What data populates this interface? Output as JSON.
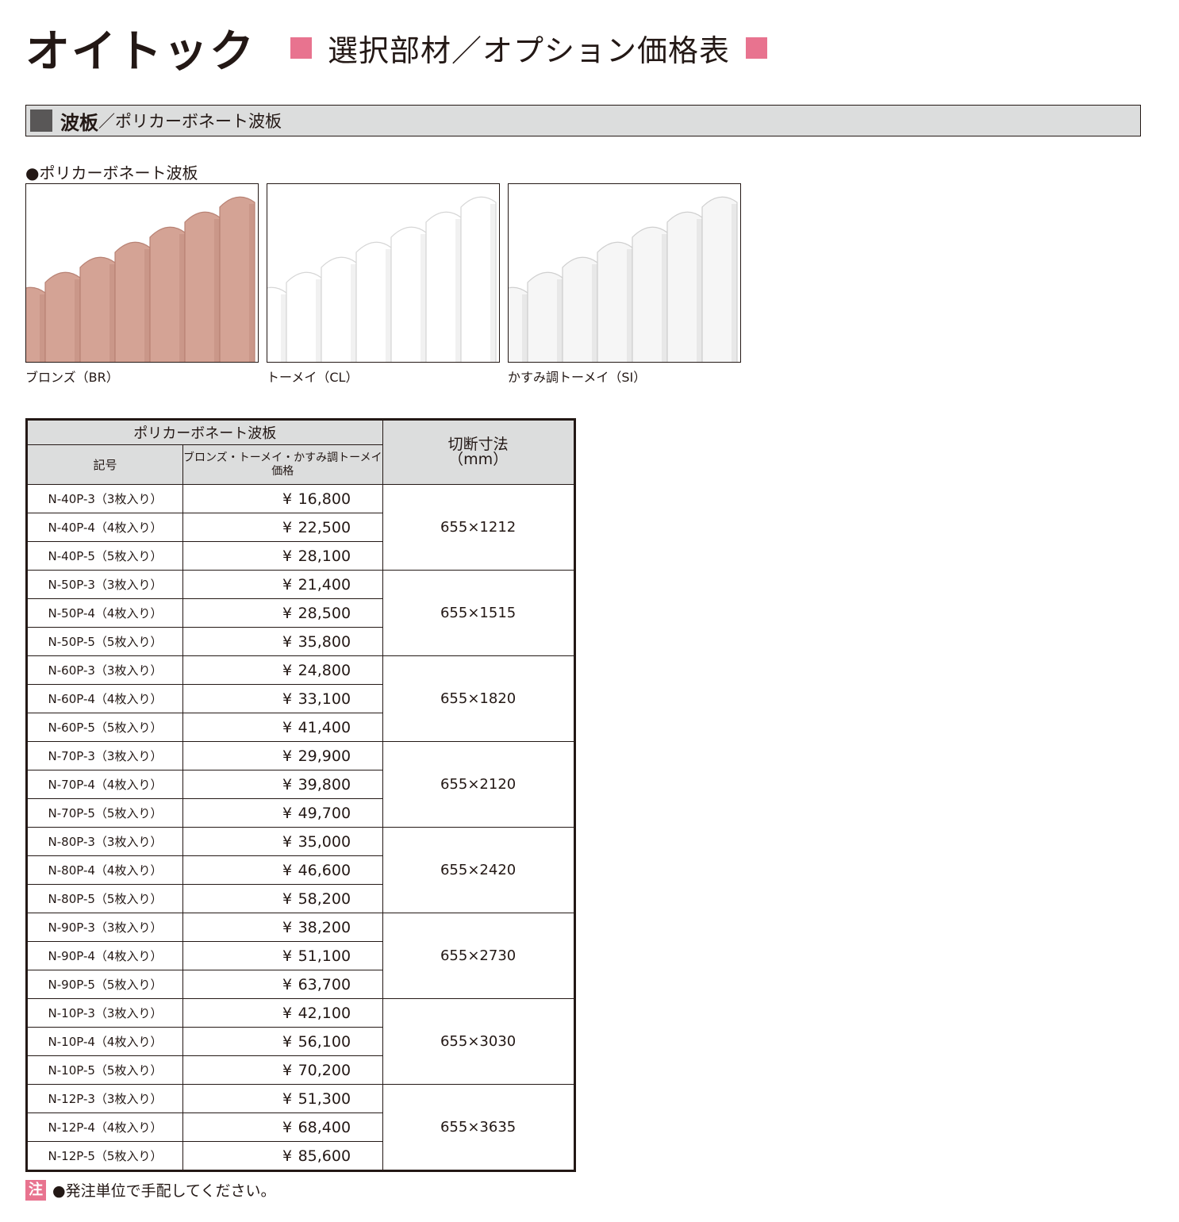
{
  "header": {
    "brand": "オイトック",
    "subtitle": "選択部材／オプション価格表"
  },
  "section": {
    "main": "波板",
    "sub": "／ポリカーボネート波板"
  },
  "products": {
    "heading": "●ポリカーボネート波板",
    "swatches": [
      {
        "caption": "ブロンズ（BR）",
        "color": "#d4a395",
        "edge": "#b88274"
      },
      {
        "caption": "トーメイ（CL）",
        "color": "#ffffff",
        "edge": "#d6d6d6"
      },
      {
        "caption": "かすみ調トーメイ（SI）",
        "color": "#f6f6f6",
        "edge": "#cfcfcf"
      }
    ]
  },
  "table": {
    "group_header": "ポリカーボネート波板",
    "code_header": "記号",
    "price_header_line1": "ブロンズ・トーメイ・かすみ調トーメイ",
    "price_header_line2": "価格",
    "cut_header_line1": "切断寸法",
    "cut_header_line2": "（mm）",
    "currency": "¥",
    "groups": [
      {
        "size": "655×1212",
        "rows": [
          {
            "code": "N-40P-3（3枚入り）",
            "price": "16,800"
          },
          {
            "code": "N-40P-4（4枚入り）",
            "price": "22,500"
          },
          {
            "code": "N-40P-5（5枚入り）",
            "price": "28,100"
          }
        ]
      },
      {
        "size": "655×1515",
        "rows": [
          {
            "code": "N-50P-3（3枚入り）",
            "price": "21,400"
          },
          {
            "code": "N-50P-4（4枚入り）",
            "price": "28,500"
          },
          {
            "code": "N-50P-5（5枚入り）",
            "price": "35,800"
          }
        ]
      },
      {
        "size": "655×1820",
        "rows": [
          {
            "code": "N-60P-3（3枚入り）",
            "price": "24,800"
          },
          {
            "code": "N-60P-4（4枚入り）",
            "price": "33,100"
          },
          {
            "code": "N-60P-5（5枚入り）",
            "price": "41,400"
          }
        ]
      },
      {
        "size": "655×2120",
        "rows": [
          {
            "code": "N-70P-3（3枚入り）",
            "price": "29,900"
          },
          {
            "code": "N-70P-4（4枚入り）",
            "price": "39,800"
          },
          {
            "code": "N-70P-5（5枚入り）",
            "price": "49,700"
          }
        ]
      },
      {
        "size": "655×2420",
        "rows": [
          {
            "code": "N-80P-3（3枚入り）",
            "price": "35,000"
          },
          {
            "code": "N-80P-4（4枚入り）",
            "price": "46,600"
          },
          {
            "code": "N-80P-5（5枚入り）",
            "price": "58,200"
          }
        ]
      },
      {
        "size": "655×2730",
        "rows": [
          {
            "code": "N-90P-3（3枚入り）",
            "price": "38,200"
          },
          {
            "code": "N-90P-4（4枚入り）",
            "price": "51,100"
          },
          {
            "code": "N-90P-5（5枚入り）",
            "price": "63,700"
          }
        ]
      },
      {
        "size": "655×3030",
        "rows": [
          {
            "code": "N-10P-3（3枚入り）",
            "price": "42,100"
          },
          {
            "code": "N-10P-4（4枚入り）",
            "price": "56,100"
          },
          {
            "code": "N-10P-5（5枚入り）",
            "price": "70,200"
          }
        ]
      },
      {
        "size": "655×3635",
        "rows": [
          {
            "code": "N-12P-3（3枚入り）",
            "price": "51,300"
          },
          {
            "code": "N-12P-4（4枚入り）",
            "price": "68,400"
          },
          {
            "code": "N-12P-5（5枚入り）",
            "price": "85,600"
          }
        ]
      }
    ]
  },
  "note": {
    "badge": "注",
    "text": "●発注単位で手配してください。"
  },
  "colors": {
    "accent_pink": "#e8738f",
    "header_gray": "#dcdddd",
    "dark_square": "#595757"
  }
}
